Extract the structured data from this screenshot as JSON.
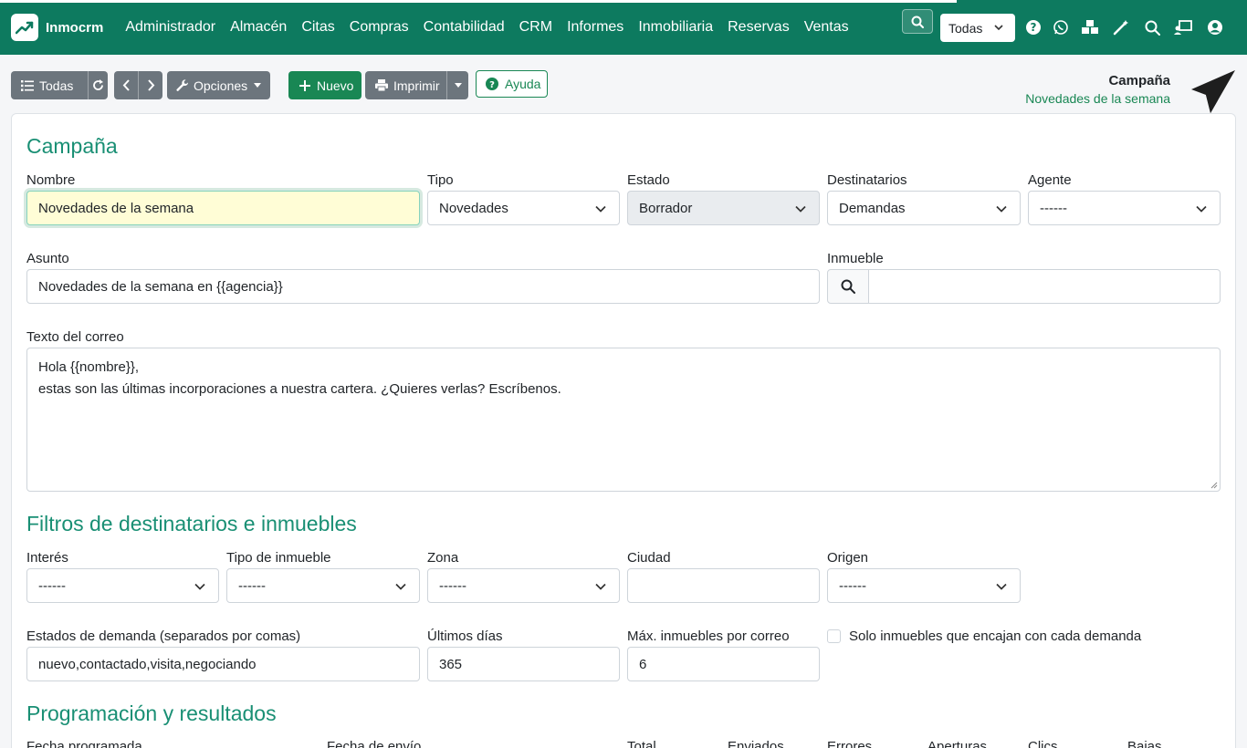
{
  "navbar": {
    "brand": "Inmocrm",
    "menu": [
      "Administrador",
      "Almacén",
      "Citas",
      "Compras",
      "Contabilidad",
      "CRM",
      "Informes",
      "Inmobiliaria",
      "Reservas",
      "Ventas"
    ],
    "company_select": "Todas"
  },
  "toolbar": {
    "all_label": "Todas",
    "options_label": "Opciones",
    "new_label": "Nuevo",
    "print_label": "Imprimir",
    "help_label": "Ayuda"
  },
  "header": {
    "title": "Campaña",
    "subtitle": "Novedades de la semana"
  },
  "form": {
    "section_title": "Campaña",
    "nombre": {
      "label": "Nombre",
      "value": "Novedades de la semana"
    },
    "tipo": {
      "label": "Tipo",
      "value": "Novedades"
    },
    "estado": {
      "label": "Estado",
      "value": "Borrador"
    },
    "destinatarios": {
      "label": "Destinatarios",
      "value": "Demandas"
    },
    "agente": {
      "label": "Agente",
      "value": "------"
    },
    "asunto": {
      "label": "Asunto",
      "value": "Novedades de la semana en {{agencia}}"
    },
    "inmueble": {
      "label": "Inmueble",
      "value": ""
    },
    "texto": {
      "label": "Texto del correo",
      "line1": "Hola {{nombre}},",
      "line2": "estas son las últimas incorporaciones a nuestra cartera. ¿Quieres verlas? Escríbenos."
    }
  },
  "filters": {
    "section_title": "Filtros de destinatarios e inmuebles",
    "interes": {
      "label": "Interés",
      "value": "------"
    },
    "tipo_inmueble": {
      "label": "Tipo de inmueble",
      "value": "------"
    },
    "zona": {
      "label": "Zona",
      "value": "------"
    },
    "ciudad": {
      "label": "Ciudad",
      "value": ""
    },
    "origen": {
      "label": "Origen",
      "value": "------"
    },
    "estados_demanda": {
      "label": "Estados de demanda (separados por comas)",
      "value": "nuevo,contactado,visita,negociando"
    },
    "ultimos_dias": {
      "label": "Últimos días",
      "value": "365"
    },
    "max_inmuebles": {
      "label": "Máx. inmuebles por correo",
      "value": "6"
    },
    "solo_encajan": {
      "label": "Solo inmuebles que encajan con cada demanda"
    }
  },
  "schedule": {
    "section_title": "Programación y resultados",
    "columns": [
      "Fecha programada",
      "Fecha de envío",
      "Total",
      "Enviados",
      "Errores",
      "Aperturas",
      "Clics",
      "Bajas"
    ]
  }
}
